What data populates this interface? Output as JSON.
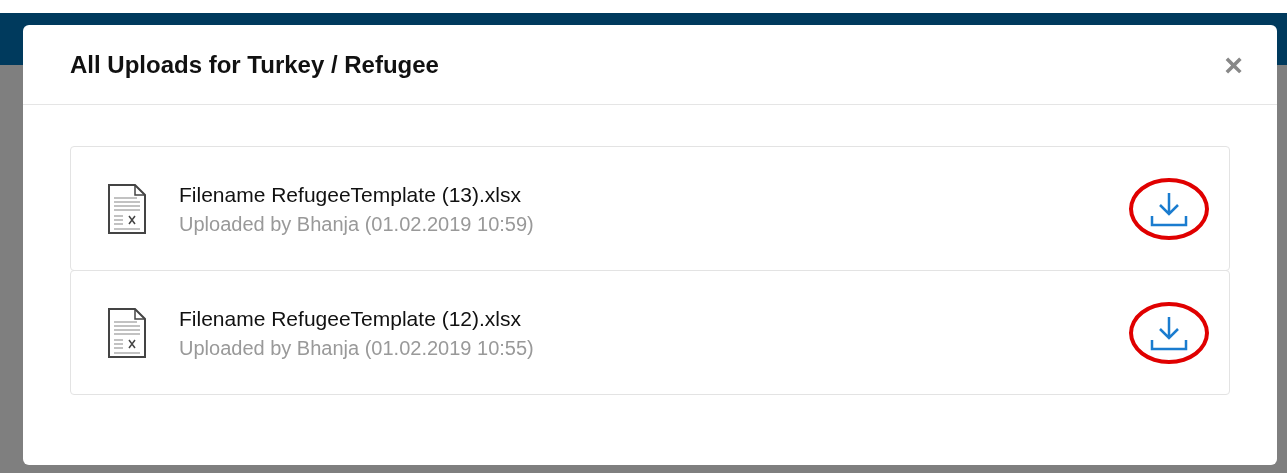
{
  "dialog": {
    "title": "All Uploads for Turkey / Refugee",
    "close": "×"
  },
  "files": [
    {
      "name": "Filename RefugeeTemplate (13).xlsx",
      "meta": "Uploaded by Bhanja (01.02.2019 10:59)",
      "highlighted": true
    },
    {
      "name": "Filename RefugeeTemplate (12).xlsx",
      "meta": "Uploaded by Bhanja (01.02.2019 10:55)",
      "highlighted": true
    }
  ]
}
